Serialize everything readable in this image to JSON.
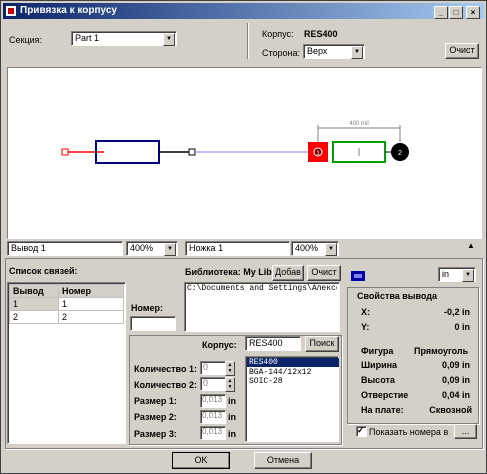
{
  "window": {
    "title": "Привязка к корпусу"
  },
  "top": {
    "section_label": "Секция:",
    "section_value": "Part 1",
    "package_label": "Корпус:",
    "package_value": "RES400",
    "side_label": "Сторона:",
    "side_value": "Верх",
    "clear_button": "Очист"
  },
  "canvas": {
    "dimension_label": "400 mil",
    "pin1_label": "1",
    "pin2_label": "2"
  },
  "fields": {
    "pin_field_value": "Вывод 1",
    "zoom_left": "400%",
    "pad_field_value": "Ножка 1",
    "zoom_right": "400%"
  },
  "links": {
    "label": "Список связей:",
    "columns": [
      "Вывод",
      "Номер"
    ],
    "rows": [
      [
        "1",
        "1"
      ],
      [
        "2",
        "2"
      ]
    ],
    "number_label": "Номер:",
    "number_value": ""
  },
  "library": {
    "label": "Библиотека: My Libra",
    "add_button": "Добав",
    "clear_button": "Очист",
    "path": "C:\\Documents and Settings\\Алексей\\"
  },
  "search": {
    "package_label": "Корпус:",
    "package_value": "RES400",
    "search_button": "Поиск",
    "results": [
      "RES400",
      "BGA-144/12x12",
      "SOIC-28"
    ]
  },
  "params": {
    "count1_label": "Количество 1:",
    "count1_value": "0",
    "count2_label": "Количество 2:",
    "count2_value": "0",
    "size1_label": "Размер 1:",
    "size1_value": "0,013",
    "size2_label": "Размер 2:",
    "size2_value": "0,013",
    "size3_label": "Размер 3:",
    "size3_value": "0,013",
    "unit": "in"
  },
  "properties": {
    "units_value": "in",
    "title": "Свойства вывода",
    "x_label": "X:",
    "x_value": "-0,2 in",
    "y_label": "Y:",
    "y_value": "0 in",
    "shape_label": "Фигура",
    "shape_value": "Прямоуголь",
    "width_label": "Ширина",
    "width_value": "0,09 in",
    "height_label": "Высота",
    "height_value": "0,09 in",
    "hole_label": "Отверстие",
    "hole_value": "0,04 in",
    "board_label": "На плате:",
    "board_value": "Сквозной",
    "show_numbers_label": "Показать номера в",
    "show_numbers_checked": true,
    "more_button": "..."
  },
  "footer": {
    "ok": "OK",
    "cancel": "Отмена"
  },
  "colors": {
    "title_start": "#0a246a",
    "title_end": "#a6caf0",
    "pin_red": "#ff0000",
    "body_blue": "#000080",
    "pad_green": "#00a000"
  }
}
